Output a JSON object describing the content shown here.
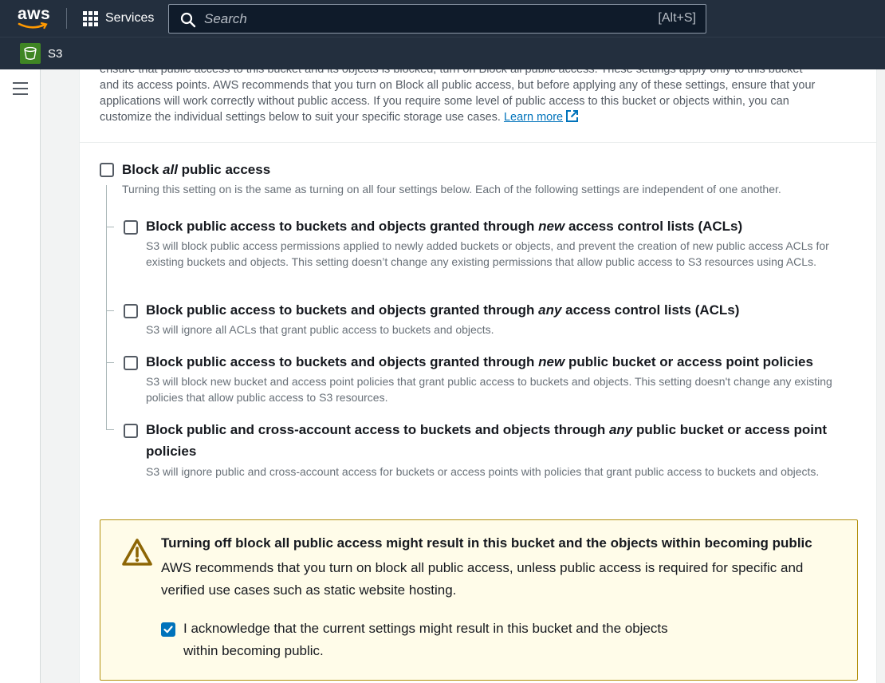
{
  "topnav": {
    "logo_text": "aws",
    "services_label": "Services",
    "search_placeholder": "Search",
    "search_shortcut": "[Alt+S]"
  },
  "servicebar": {
    "service_name": "S3"
  },
  "intro": {
    "line1": "ensure that public access to this bucket and its objects is blocked, turn on Block all public access. These settings apply only to this bucket",
    "line2": "and its access points. AWS recommends that you turn on Block all public access, but before applying any of these settings, ensure that your",
    "line3": "applications will work correctly without public access. If you require some level of public access to this bucket or objects within, you can",
    "line4": "customize the individual settings below to suit your specific storage use cases.",
    "learn_more": "Learn more"
  },
  "block_all": {
    "title_pre": "Block ",
    "title_em": "all",
    "title_post": " public access",
    "description": "Turning this setting on is the same as turning on all four settings below. Each of the following settings are independent of one another.",
    "checked": false
  },
  "options": [
    {
      "title_pre": "Block public access to buckets and objects granted through ",
      "title_em": "new",
      "title_post": " access control lists (ACLs)",
      "description": "S3 will block public access permissions applied to newly added buckets or objects, and prevent the creation of new public access ACLs for existing buckets and objects. This setting doesn’t change any existing permissions that allow public access to S3 resources using ACLs.",
      "checked": false
    },
    {
      "title_pre": "Block public access to buckets and objects granted through ",
      "title_em": "any",
      "title_post": " access control lists (ACLs)",
      "description": "S3 will ignore all ACLs that grant public access to buckets and objects.",
      "checked": false
    },
    {
      "title_pre": "Block public access to buckets and objects granted through ",
      "title_em": "new",
      "title_post": " public bucket or access point policies",
      "description": "S3 will block new bucket and access point policies that grant public access to buckets and objects. This setting doesn't change any existing policies that allow public access to S3 resources.",
      "checked": false
    },
    {
      "title_pre": "Block public and cross-account access to buckets and objects through ",
      "title_em": "any",
      "title_post": " public bucket or access point policies",
      "description": "S3 will ignore public and cross-account access for buckets or access points with policies that grant public access to buckets and objects.",
      "checked": false
    }
  ],
  "warning": {
    "title": "Turning off block all public access might result in this bucket and the objects within becoming public",
    "description": "AWS recommends that you turn on block all public access, unless public access is required for specific and verified use cases such as static website hosting.",
    "acknowledge_label": "I acknowledge that the current settings might result in this bucket and the objects within becoming public.",
    "acknowledge_checked": true
  },
  "colors": {
    "nav_bg": "#232f3e",
    "link": "#0073bb",
    "warning_bg": "#fffce9",
    "warning_border": "#b3910e",
    "s3_green": "#3f8624"
  }
}
